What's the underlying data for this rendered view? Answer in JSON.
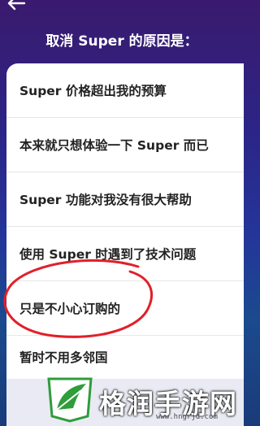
{
  "header": {
    "back_icon": "back-arrow-icon",
    "title": "取消 Super 的原因是："
  },
  "reasons": [
    "Super 价格超出我的预算",
    "本来就只想体验一下 Super 而已",
    "Super 功能对我没有很大帮助",
    "使用 Super 时遇到了技术问题",
    "只是不小心订购的",
    "暂时不用多邻国"
  ],
  "annotation": {
    "color": "#e0202a",
    "circled_reason_index": 4
  },
  "watermark": {
    "brand": "格润手游网",
    "url": "www.hngrjd.com",
    "green": "#2e9d3a"
  }
}
